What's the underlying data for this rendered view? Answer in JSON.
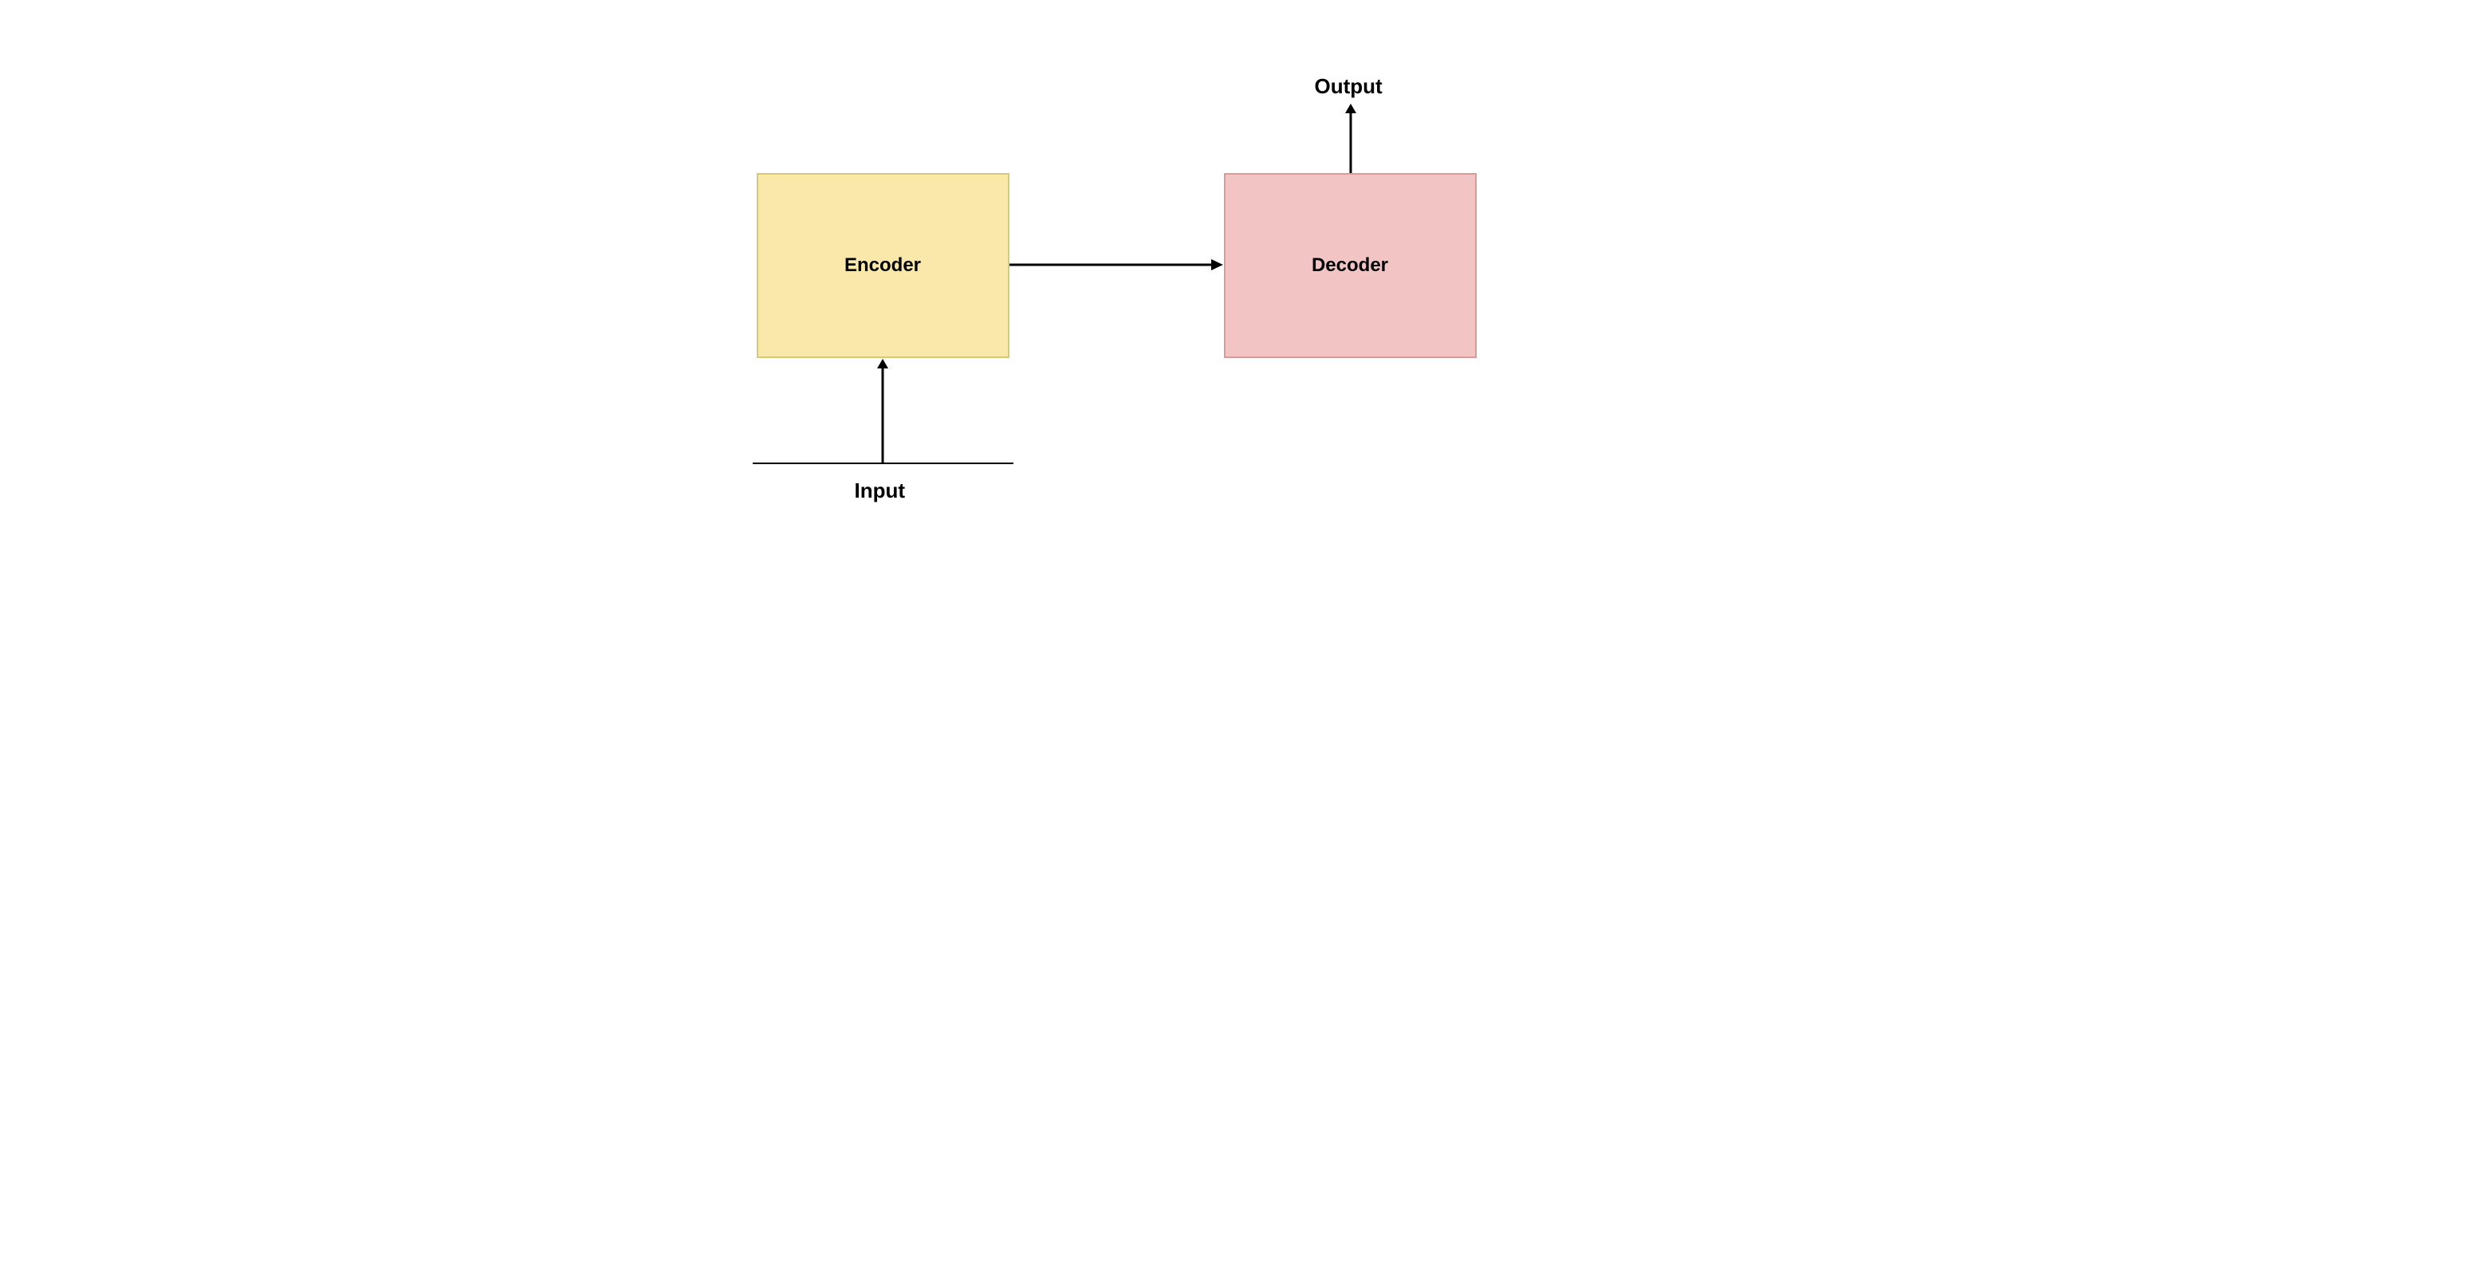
{
  "diagram": {
    "encoder_label": "Encoder",
    "decoder_label": "Decoder",
    "input_label": "Input",
    "output_label": "Output",
    "colors": {
      "encoder_bg": "#f9e8a9",
      "encoder_border": "#d9c878",
      "decoder_bg": "#f3c4c4",
      "decoder_border": "#d99a9a"
    },
    "arrows": [
      {
        "from": "Input",
        "to": "Encoder",
        "direction": "up"
      },
      {
        "from": "Encoder",
        "to": "Decoder",
        "direction": "right"
      },
      {
        "from": "Decoder",
        "to": "Output",
        "direction": "up"
      }
    ]
  }
}
